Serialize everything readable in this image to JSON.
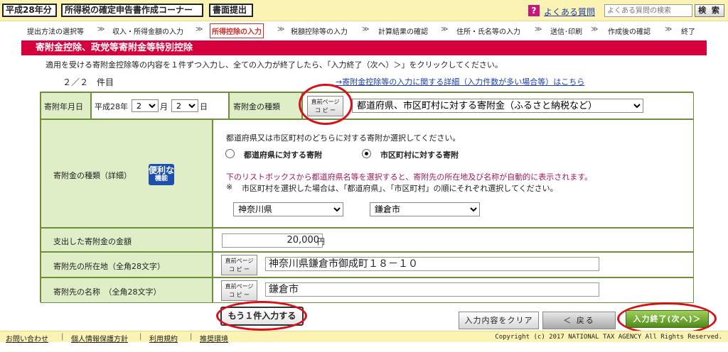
{
  "header": {
    "year": "平成28年分",
    "corner": "所得税の確定申告書作成コーナー",
    "submit": "書面提出",
    "faq_icon": "?",
    "faq_link": "よくある質問",
    "faq_search_placeholder": "よくある質問の検索",
    "search_button": "検 索"
  },
  "steps": [
    "提出方法の選択等",
    "収入・所得金額の入力",
    "所得控除の入力",
    "税額控除等の入力",
    "計算結果の確認",
    "住所・氏名等の入力",
    "送信･印刷",
    "作成後の確認",
    "終了"
  ],
  "step_separator": "≫",
  "section": {
    "title": "寄附金控除、政党等寄附金等特別控除",
    "instruction": "適用を受ける寄附金控除等の内容を１件ずつ入力し、全ての入力が終了したら、「入力終了（次へ）＞」をクリックしてください。",
    "page_counter": "２／２　件目",
    "details_link": "→寄附金控除等の入力に関する詳細（入力件数が多い場合等）はこちら"
  },
  "form": {
    "date_label": "寄附年月日",
    "era": "平成28年",
    "month_value": "2",
    "month_unit": "月",
    "day_value": "2",
    "day_unit": "日",
    "type_label": "寄附金の種類",
    "copy_button_line1": "直前ページ",
    "copy_button_line2": "コ ピ ー",
    "type_value": "都道府県、市区町村に対する寄附金（ふるさと納税など）",
    "detail_label": "寄附金の種類（詳細）",
    "benri_line1": "便利な",
    "benri_line2": "機能",
    "recipient_question": "都道府県又は市区町村のどちらに対する寄附か選択してください。",
    "radio_pref": "都道府県に対する寄附",
    "radio_city": "市区町村に対する寄附",
    "red_note": "下のリストボックスから都道府県名等を選択すると、寄附先の所在地及び名称が自動的に表示されます。",
    "note_mark": "※",
    "note": "市区町村を選択した場合は、「都道府県」、「市区町村」の順にそれぞれ選択してください。",
    "prefecture": "神奈川県",
    "city": "鎌倉市",
    "amount_label": "支出した寄附金の金額",
    "amount_value": "20,000",
    "amount_unit": "円",
    "address_label": "寄附先の所在地（全角28文字）",
    "address_value": "神奈川県鎌倉市御成町１８－１０",
    "name_label": "寄附先の名称　（全角28文字）",
    "name_value": "鎌倉市"
  },
  "buttons": {
    "add_another": "もう１件入力する",
    "clear": "入力内容をクリア",
    "back": "＜ 戻る",
    "finish": "入力終了(次へ)＞"
  },
  "footer": {
    "links": [
      "お問い合わせ",
      "個人情報保護方針",
      "利用規約",
      "推奨環境"
    ],
    "separator": "|",
    "copyright": "Copyright (c) 2017 NATIONAL TAX AGENCY All Rights Reserved."
  },
  "colors": {
    "header_bg": "#fbf3b4",
    "section_red": "#d5003c",
    "label_green": "#dfeec6",
    "border_green": "#6e8f3a",
    "annotation_red": "#d8101a",
    "finish_green": "#4e8a1a"
  }
}
